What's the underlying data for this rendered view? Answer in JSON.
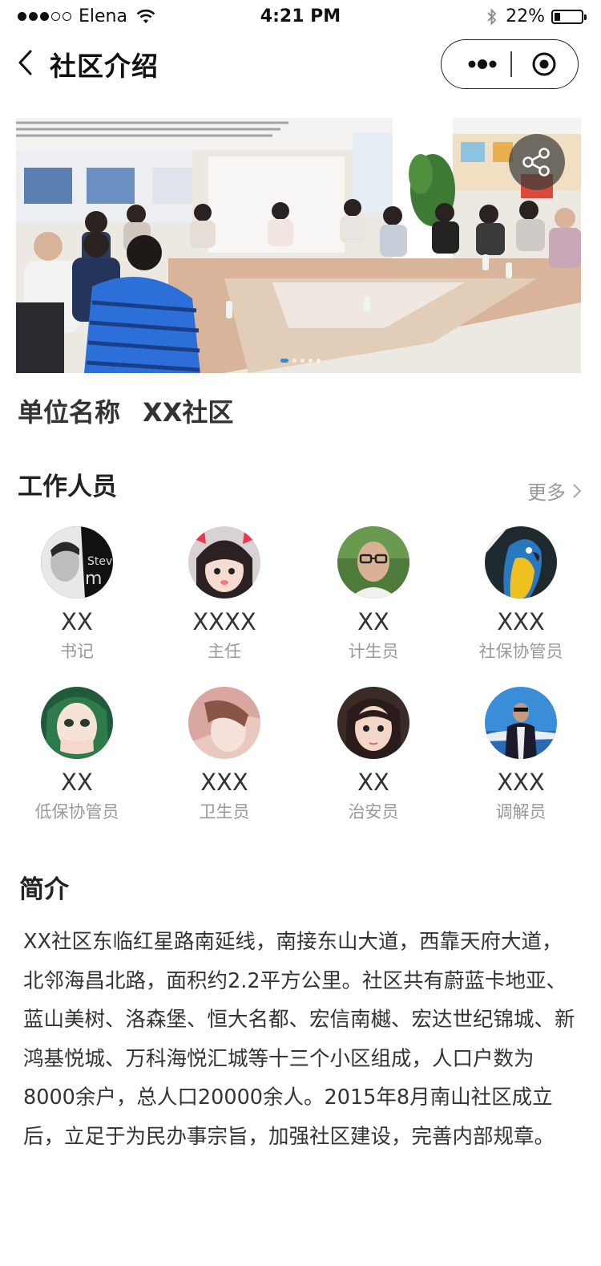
{
  "status_bar": {
    "carrier": "Elena",
    "time": "4:21 PM",
    "battery": "22%",
    "battery_level": 0.22
  },
  "nav": {
    "title": "社区介绍"
  },
  "banner": {
    "slide_count": 5,
    "active_slide": 1
  },
  "unit": {
    "label": "单位名称",
    "value": "XX社区"
  },
  "staff": {
    "title": "工作人员",
    "more": "更多",
    "members": [
      {
        "name": "XX",
        "role": "书记"
      },
      {
        "name": "XXXX",
        "role": "主任"
      },
      {
        "name": "XX",
        "role": "计生员"
      },
      {
        "name": "XXX",
        "role": "社保协管员"
      },
      {
        "name": "XX",
        "role": "低保协管员"
      },
      {
        "name": "XXX",
        "role": "卫生员"
      },
      {
        "name": "XX",
        "role": "治安员"
      },
      {
        "name": "XXX",
        "role": "调解员"
      }
    ]
  },
  "intro": {
    "title": "简介",
    "text": "XX社区东临红星路南延线，南接东山大道，西靠天府大道，北邻海昌北路，面积约2.2平方公里。社区共有蔚蓝卡地亚、蓝山美树、洛森堡、恒大名都、宏信南樾、宏达世纪锦城、新鸿基悦城、万科海悦汇城等十三个小区组成，人口户数为8000余户，总人口20000余人。2015年8月南山社区成立后，立足于为民办事宗旨，加强社区建设，完善内部规章。"
  },
  "colors": {
    "indicator_active": "#2b8ce6",
    "muted_text": "#999999"
  }
}
